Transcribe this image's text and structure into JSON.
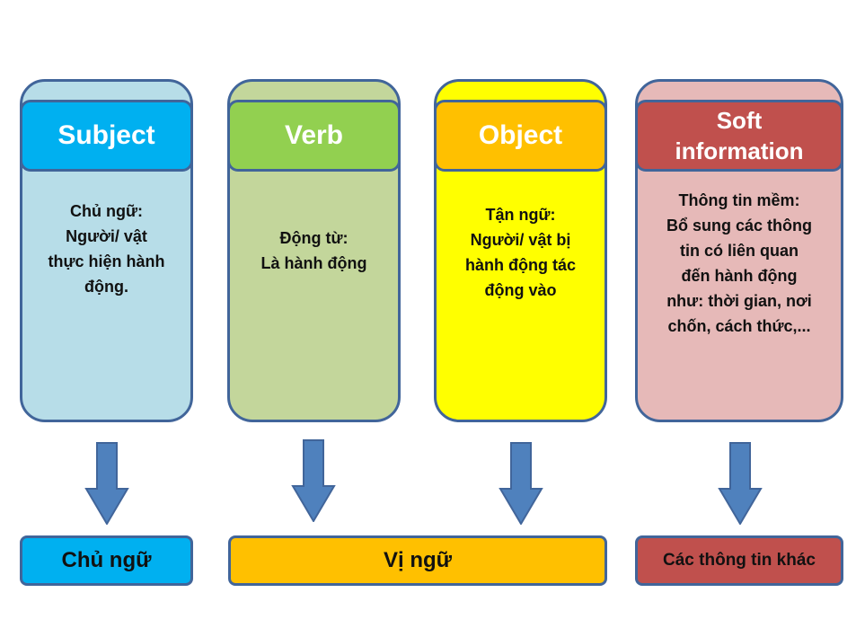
{
  "cards": [
    {
      "title": [
        "Subject"
      ],
      "body": [
        "Chủ ngữ:",
        "Người/ vật",
        "thực hiện hành",
        "động."
      ],
      "header_color": "#00b0f0",
      "body_color": "#b7dde8"
    },
    {
      "title": [
        "Verb"
      ],
      "body": [
        "Động từ:",
        "Là hành động"
      ],
      "header_color": "#92d050",
      "body_color": "#c3d69b"
    },
    {
      "title": [
        "Object"
      ],
      "body": [
        "Tận ngữ:",
        "Người/ vật bị",
        "hành động tác",
        "động vào"
      ],
      "header_color": "#ffc000",
      "body_color": "#ffff00"
    },
    {
      "title": [
        "Soft",
        "information"
      ],
      "body": [
        "Thông tin mềm:",
        "Bổ sung các thông",
        "tin có liên quan",
        "đến hành động",
        "như: thời gian, nơi",
        "chốn, cách thức,..."
      ],
      "header_color": "#c0504d",
      "body_color": "#e6b9b8"
    }
  ],
  "arrows": {
    "color": "#4f81bd",
    "stroke": "#41659a",
    "icon": "arrow-down-icon"
  },
  "bottom": [
    {
      "label": "Chủ ngữ",
      "color": "#00b0f0"
    },
    {
      "label": "Vị ngữ",
      "color": "#ffc000"
    },
    {
      "label": "Các thông tin khác",
      "color": "#c0504d"
    }
  ]
}
